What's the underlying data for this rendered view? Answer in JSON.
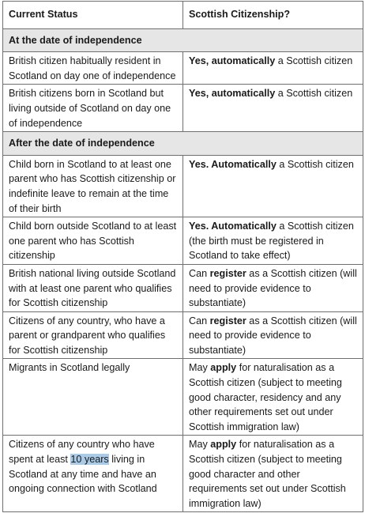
{
  "headers": {
    "status": "Current Status",
    "citizenship": "Scottish Citizenship?"
  },
  "section1": "At the date of independence",
  "section2": "After the date of independence",
  "rows": [
    {
      "status": "British citizen habitually resident in Scotland on day one of independence",
      "bold": "Yes, automatically",
      "rest": " a Scottish citizen"
    },
    {
      "status": "British citizens born in Scotland but living outside of Scotland on day one of independence",
      "bold": "Yes, automatically",
      "rest": " a Scottish citizen"
    },
    {
      "status": "Child born in Scotland to at least one parent who has Scottish citizenship or indefinite leave to remain at the time of their birth",
      "bold": "Yes. Automatically",
      "rest": " a Scottish citizen"
    },
    {
      "status": "Child born outside Scotland to at least one parent who has Scottish citizenship",
      "bold": "Yes. Automatically",
      "rest": " a Scottish citizen (the birth must be registered in Scotland to take effect)"
    },
    {
      "status": "British national living outside Scotland with at least one parent who qualifies for Scottish citizenship",
      "pre": "Can ",
      "bold": "register",
      "rest": " as a Scottish citizen (will need to provide evidence to substantiate)"
    },
    {
      "status": "Citizens of any country, who have a parent or grandparent who qualifies for Scottish citizenship",
      "pre": "Can ",
      "bold": "register",
      "rest": " as a Scottish citizen (will need to provide evidence to substantiate)"
    },
    {
      "status": "Migrants in Scotland legally",
      "pre": "May ",
      "bold": "apply",
      "rest": " for naturalisation as a Scottish citizen (subject to meeting good character, residency and any other requirements set out under Scottish immigration law)"
    },
    {
      "status_pre": "Citizens of any country who have spent at least ",
      "status_hl": "10 years",
      "status_post": " living in Scotland at any time and have an ongoing connection with Scotland",
      "pre": "May ",
      "bold": "apply",
      "rest": " for naturalisation as a Scottish citizen (subject to meeting good character and other requirements set out under Scottish immigration law)"
    }
  ],
  "colors": {
    "border": "#6f6f6f",
    "section_bg": "#e6e6e6",
    "highlight": "#a9cbe8"
  }
}
